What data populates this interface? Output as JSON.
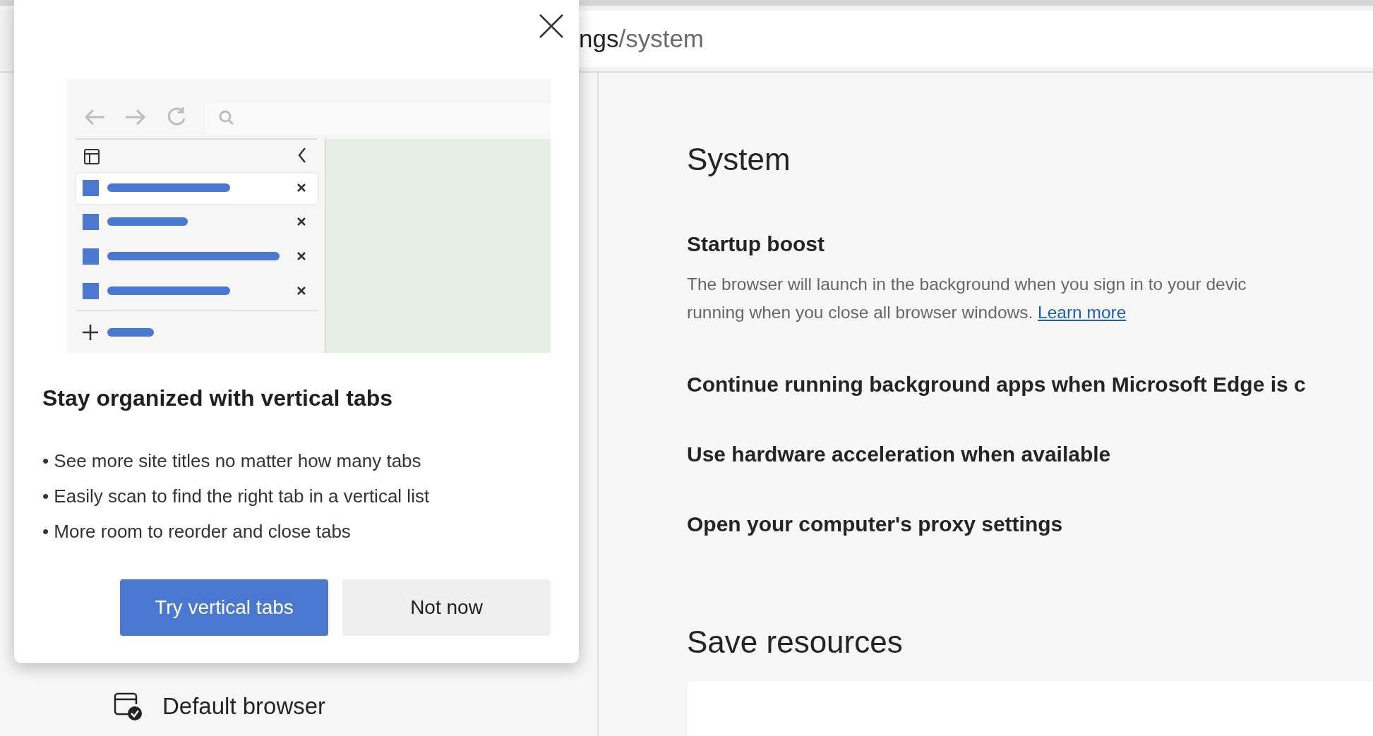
{
  "address_bar": {
    "url_start": "ngs",
    "url_rest": "/system"
  },
  "sidebar": {
    "items": [
      {
        "label": "Default browser"
      }
    ]
  },
  "content": {
    "heading": "System",
    "settings": [
      {
        "title": "Startup boost",
        "description_lines": [
          "The browser will launch in the background when you sign in to your devic",
          "running when you close all browser windows."
        ],
        "link": "Learn more"
      },
      {
        "title": "Continue running background apps when Microsoft Edge is c"
      },
      {
        "title": "Use hardware acceleration when available"
      },
      {
        "title": "Open your computer's proxy settings"
      }
    ],
    "section_heading": "Save resources"
  },
  "popup": {
    "title": "Stay organized with vertical tabs",
    "bullets": [
      "• See more site titles no matter how many tabs",
      "• Easily scan to find the right tab in a vertical list",
      "• More room to reorder and close tabs"
    ],
    "buttons": [
      {
        "label": "Try vertical tabs",
        "kind": "primary"
      },
      {
        "label": "Not now",
        "kind": "secondary"
      }
    ]
  }
}
